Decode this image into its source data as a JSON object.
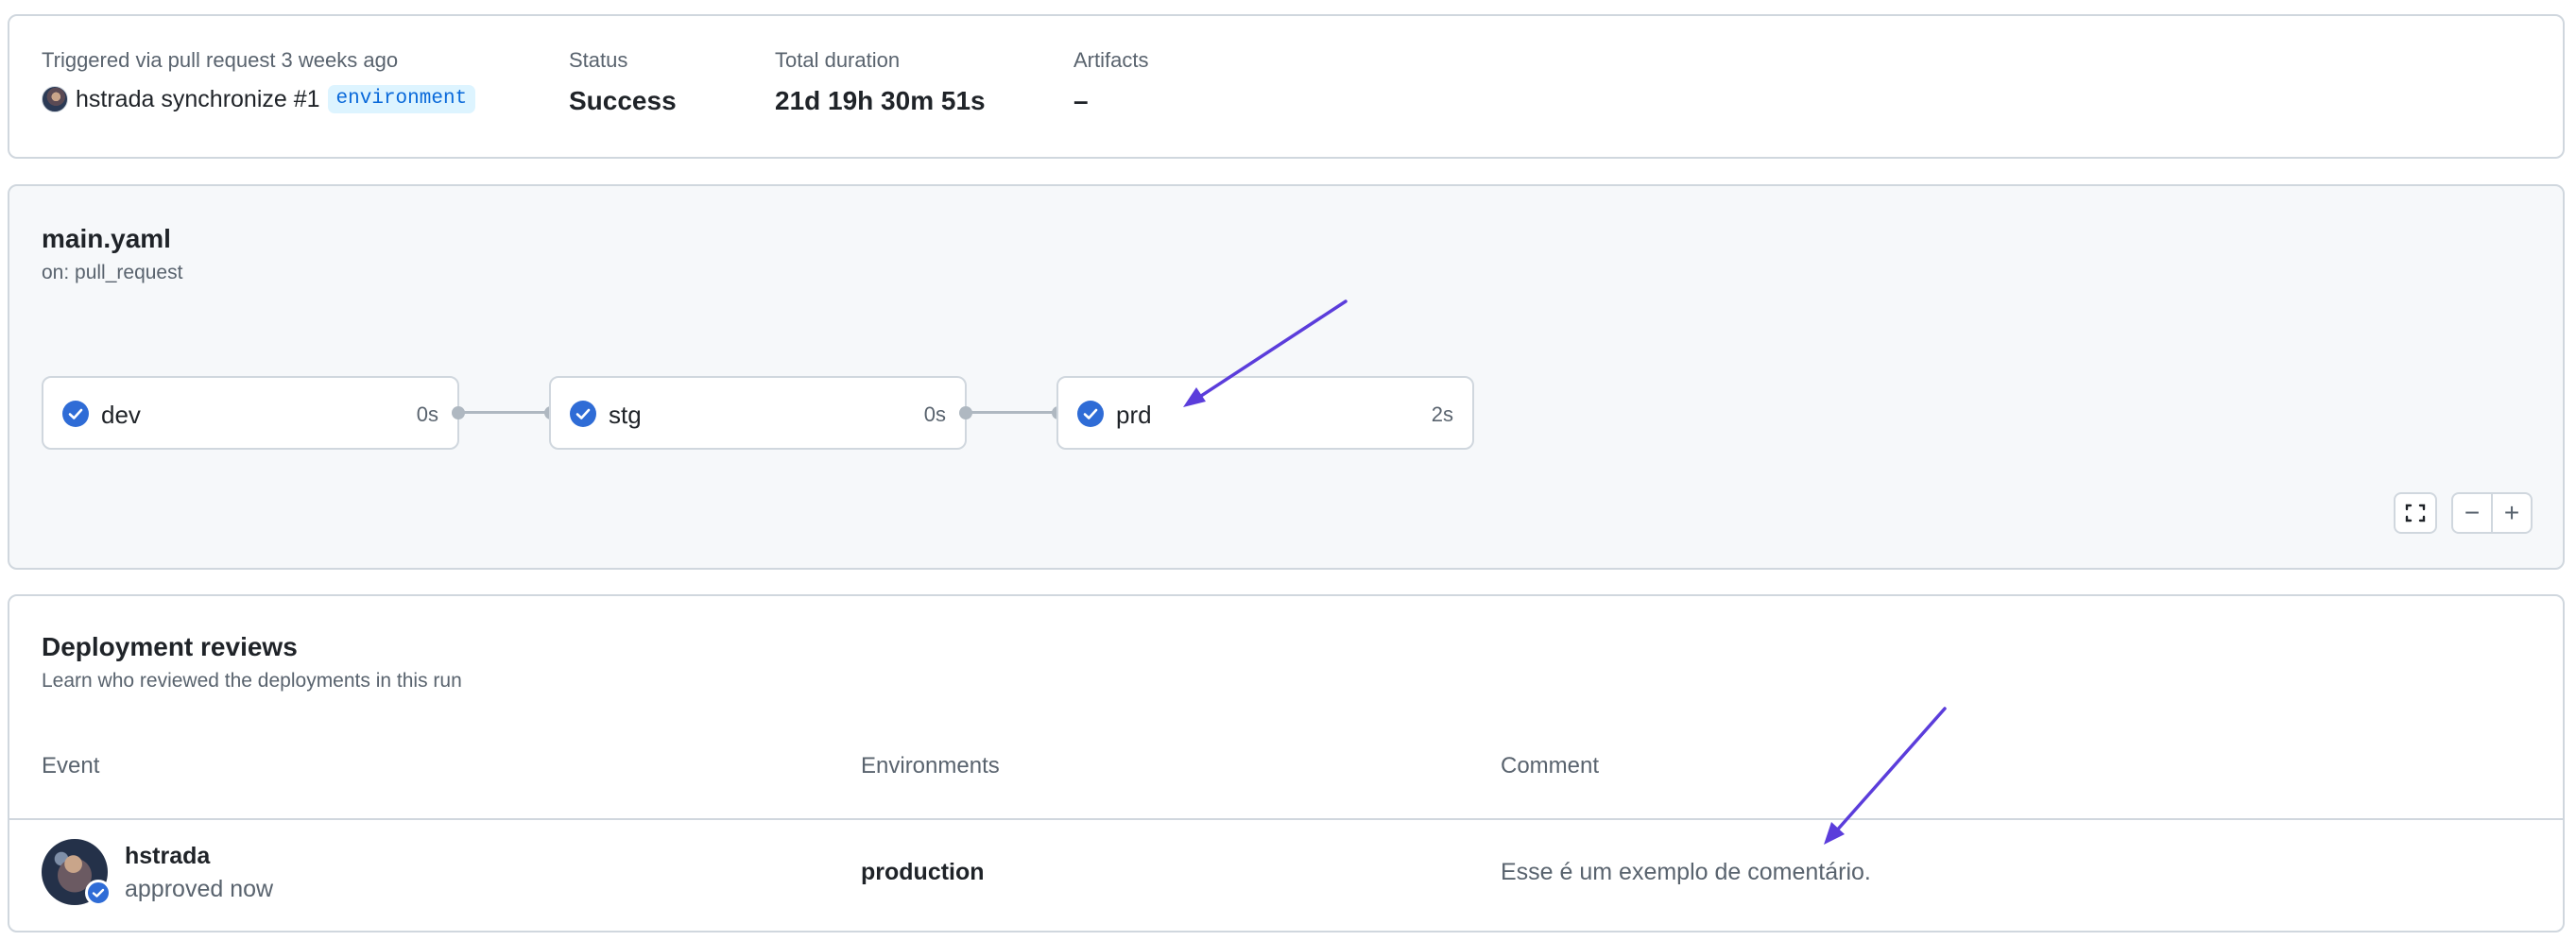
{
  "summary": {
    "trigger_label": "Triggered via pull request 3 weeks ago",
    "actor": "hstrada",
    "event": "synchronize #1",
    "branch_badge": "environment",
    "status_label": "Status",
    "status_value": "Success",
    "duration_label": "Total duration",
    "duration_value": "21d 19h 30m 51s",
    "artifacts_label": "Artifacts",
    "artifacts_value": "–"
  },
  "workflow": {
    "file": "main.yaml",
    "trigger": "on: pull_request",
    "jobs": [
      {
        "name": "dev",
        "duration": "0s",
        "status": "success"
      },
      {
        "name": "stg",
        "duration": "0s",
        "status": "success"
      },
      {
        "name": "prd",
        "duration": "2s",
        "status": "success"
      }
    ],
    "controls": {
      "fullscreen_icon": "fullscreen-icon",
      "zoom_out": "−",
      "zoom_in": "+"
    }
  },
  "reviews": {
    "title": "Deployment reviews",
    "subtitle": "Learn who reviewed the deployments in this run",
    "columns": [
      "Event",
      "Environments",
      "Comment"
    ],
    "rows": [
      {
        "user": "hstrada",
        "state": "approved now",
        "environment": "production",
        "comment": "Esse é um exemplo de comentário."
      }
    ]
  },
  "colors": {
    "success_check": "#2f6cd6",
    "annotation_arrow": "#5b3ddb",
    "border": "#d0d7de",
    "badge_bg": "#ddf4ff",
    "badge_fg": "#0969da"
  }
}
